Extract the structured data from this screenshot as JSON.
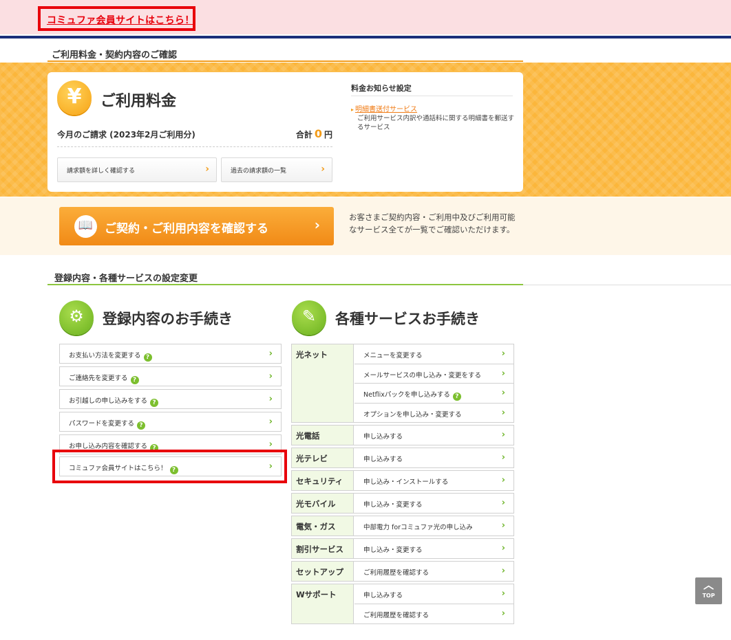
{
  "banner": {
    "member_link": "コミュファ会員サイトはこちら！"
  },
  "billing_section": {
    "title": "ご利用料金・契約内容のご確認",
    "fee_card": {
      "heading": "ご利用料金",
      "icon_symbol": "¥",
      "bill_label": "今月のご請求 (2023年2月ご利用分)",
      "total_label": "合計",
      "total_amount": "0",
      "total_unit": "円",
      "detail_button": "請求額を詳しく確認する",
      "past_button": "過去の請求額の一覧"
    },
    "notice": {
      "title": "料金お知らせ設定",
      "link": "明細書送付サービス",
      "description": "ご利用サービス内訳や通話料に関する明細書を郵送するサービス"
    },
    "contract": {
      "button_label": "ご契約・ご利用内容を確認する",
      "description": "お客さまご契約内容・ご利用中及びご利用可能なサービス全てが一覧でご確認いただけます。"
    }
  },
  "settings_section": {
    "title": "登録内容・各種サービスの設定変更",
    "registration": {
      "heading": "登録内容のお手続き",
      "items": [
        {
          "label": "お支払い方法を変更する"
        },
        {
          "label": "ご連絡先を変更する"
        },
        {
          "label": "お引越しの申し込みをする"
        },
        {
          "label": "パスワードを変更する"
        },
        {
          "label": "お申し込み内容を確認する"
        },
        {
          "label": "コミュファ会員サイトはこちら！"
        }
      ]
    },
    "services": {
      "heading": "各種サービスお手続き",
      "groups": [
        {
          "category": "光ネット",
          "rows": [
            {
              "label": "メニューを変更する"
            },
            {
              "label": "メールサービスの申し込み・変更をする"
            },
            {
              "label": "Netflixパックを申し込みする"
            },
            {
              "label": "オプションを申し込み・変更する"
            }
          ]
        },
        {
          "category": "光電話",
          "rows": [
            {
              "label": "申し込みする"
            }
          ]
        },
        {
          "category": "光テレビ",
          "rows": [
            {
              "label": "申し込みする"
            }
          ]
        },
        {
          "category": "セキュリティ",
          "rows": [
            {
              "label": "申し込み・インストールする"
            }
          ]
        },
        {
          "category": "光モバイル",
          "rows": [
            {
              "label": "申し込み・変更する"
            }
          ]
        },
        {
          "category": "電気・ガス",
          "rows": [
            {
              "label": "中部電力 forコミュファ光の申し込み"
            }
          ]
        },
        {
          "category": "割引サービス",
          "rows": [
            {
              "label": "申し込み・変更する"
            }
          ]
        },
        {
          "category": "セットアップ",
          "rows": [
            {
              "label": "ご利用履歴を確認する"
            }
          ]
        },
        {
          "category": "Wサポート",
          "rows": [
            {
              "label": "申し込みする"
            },
            {
              "label": "ご利用履歴を確認する"
            }
          ]
        }
      ]
    }
  },
  "top_button": {
    "label": "TOP"
  },
  "icons": {
    "chevron": "›",
    "help": "?",
    "book": "📖",
    "gear": "⚙",
    "pen": "✎"
  },
  "colors": {
    "brand_orange": "#f39c19",
    "brand_green": "#8cc63f",
    "alert_red": "#e8000b",
    "navy_rule": "#1b2f7a"
  }
}
